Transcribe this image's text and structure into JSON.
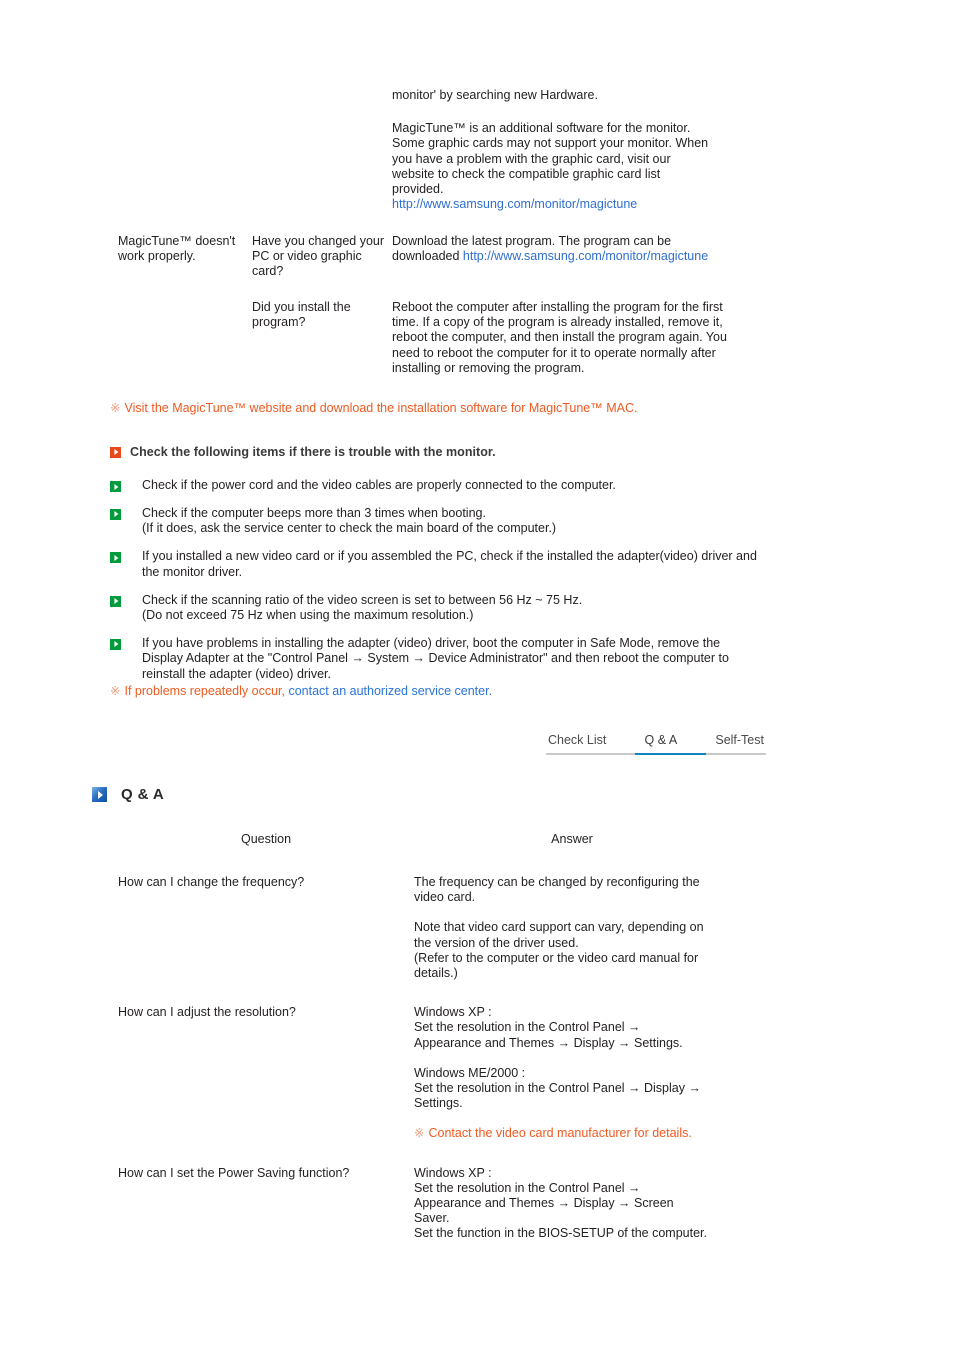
{
  "colors": {
    "text": "#231f20",
    "link": "#2f6fd0",
    "notice_orange": "#ef5a20",
    "bullet_green": "#009b3a",
    "heading_orange": "#e8481c",
    "tab_active_underline": "#1383c6",
    "qa_icon_blue": "#2a6fc4"
  },
  "intro": {
    "first_line": "monitor' by searching new Hardware.",
    "paragraph_lines": [
      "MagicTune™ is an additional software for the monitor.",
      "Some graphic cards may not support your monitor. When",
      "you have a problem with the graphic card, visit our",
      "website to check the compatible graphic card list",
      "provided."
    ],
    "link": "http://www.samsung.com/monitor/magictune"
  },
  "troubleshoot_table": {
    "rows": [
      {
        "symptom": "MagicTune™ doesn't work properly.",
        "question": "Have you changed your PC or video graphic card?",
        "answer_prefix": "Download the latest program. The program can be downloaded ",
        "answer_link": "http://www.samsung.com/monitor/magictune"
      },
      {
        "symptom": "",
        "question": "Did you install the program?",
        "answer": "Reboot the computer after installing the program for the first time. If a copy of the program is already installed, remove it, reboot the computer, and then install the program again. You need to reboot the computer for it to operate normally after installing or removing the program."
      }
    ]
  },
  "notice_1": {
    "mark": "※",
    "text": "Visit the MagicTune™ website and download the installation software for MagicTune™ MAC."
  },
  "check_heading": {
    "icon": "orange-arrow-icon",
    "text": "Check the following items if there is trouble with the monitor."
  },
  "check_items": [
    {
      "lines": [
        "Check if the power cord and the video cables are properly connected to the computer."
      ]
    },
    {
      "lines": [
        "Check if the computer beeps more than 3 times when booting.",
        "(If it does, ask the service center to check the main board of the computer.)"
      ]
    },
    {
      "lines": [
        "If you installed a new video card or if you assembled the PC, check if the installed the adapter(video) driver and the monitor driver."
      ]
    },
    {
      "lines": [
        "Check if the scanning ratio of the video screen is set to between 56 Hz ~ 75 Hz.",
        "(Do not exceed 75 Hz when using the maximum resolution.)"
      ]
    },
    {
      "lines": [
        "If you have problems in installing the adapter (video) driver, boot the computer in Safe Mode, remove the Display Adapter at the \"Control Panel → System → Device Administrator\" and then reboot the computer to reinstall the adapter (video) driver."
      ]
    }
  ],
  "notice_2": {
    "mark": "※",
    "text_orange": "If problems repeatedly occur, ",
    "text_link": "contact an authorized service center."
  },
  "tabs": {
    "items": [
      {
        "label": "Check List",
        "active": false
      },
      {
        "label": "Q & A",
        "active": true
      },
      {
        "label": "Self-Test",
        "active": false
      }
    ]
  },
  "qa_section": {
    "icon": "blue-arrow-icon",
    "title": "Q & A",
    "headers": {
      "question": "Question",
      "answer": "Answer"
    },
    "rows": [
      {
        "question": "How can I change the frequency?",
        "answer_paragraphs": [
          [
            "The frequency can be changed by reconfiguring the",
            "video card."
          ],
          [
            "Note that video card support can vary, depending on",
            "the version of the driver used.",
            "(Refer to the computer or the video card manual for",
            "details.)"
          ]
        ],
        "note": null
      },
      {
        "question": "How can I adjust the resolution?",
        "answer_paragraphs": [
          [
            "Windows XP :",
            "Set the resolution in the Control Panel →",
            "Appearance and Themes → Display → Settings."
          ],
          [
            "Windows ME/2000 :",
            "Set the resolution in the Control Panel → Display →",
            "Settings."
          ]
        ],
        "note": {
          "mark": "※",
          "text": "Contact the video card manufacturer for details."
        }
      },
      {
        "question": "How can I set the Power Saving function?",
        "answer_paragraphs": [
          [
            "Windows XP :",
            "Set the resolution in the Control Panel →",
            "Appearance and Themes → Display → Screen",
            "Saver.",
            "Set the function in the BIOS-SETUP of the computer."
          ]
        ],
        "note": null
      }
    ]
  }
}
